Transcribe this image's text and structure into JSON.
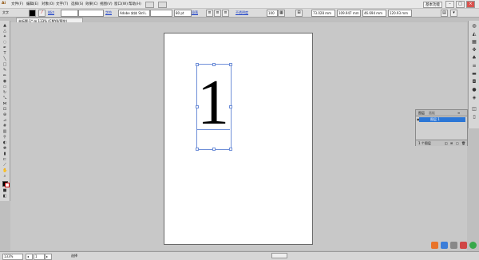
{
  "menubar": {
    "logo": "Ai",
    "items": [
      "文件(F)",
      "编辑(E)",
      "对象(O)",
      "文字(T)",
      "选择(S)",
      "效果(C)",
      "视图(V)",
      "窗口(W)",
      "帮助(H)"
    ],
    "workspace": "基本功能",
    "window_buttons": [
      "–",
      "□",
      "×"
    ]
  },
  "controlbar": {
    "mode_label": "文字",
    "tracing_label": "描边",
    "char_label": "字符",
    "font_family": "Adobe 宋体 Std L",
    "font_size": "80 pt",
    "para_label": "段落",
    "opacity_label": "不透明度",
    "opacity_value": "100",
    "x_value": "73.028 mm",
    "y_value": "109.947 mm",
    "w_value": "46.694 mm",
    "h_value": "120.93 mm"
  },
  "doc_tab": {
    "title": "未标题-1* @ 133% (CMYK/预览)"
  },
  "canvas": {
    "glyph": "1"
  },
  "layers_panel": {
    "tab1": "图层",
    "tab2": "画板",
    "layer_name": "图层 1",
    "footer": "1 个图层"
  },
  "statusbar": {
    "zoom": "133%",
    "page": "1",
    "tool": "选择"
  },
  "colors": {
    "selection": "#6f8fd8",
    "layer_highlight": "#2b76d6",
    "link": "#1a3fc8"
  }
}
